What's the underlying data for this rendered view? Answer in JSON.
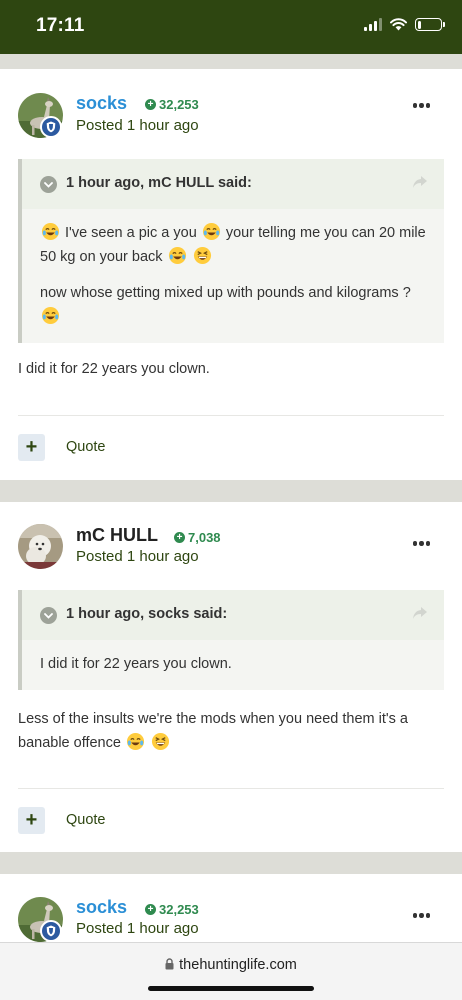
{
  "status_bar": {
    "time": "17:11",
    "battery_level": 0.15
  },
  "posts": [
    {
      "author": "socks",
      "author_color": "#2b8fd6",
      "reputation": "32,253",
      "posted": "Posted 1 hour ago",
      "moderator_badge": true,
      "avatar": "dog-avatar",
      "quote": {
        "cite": "1 hour ago, mC HULL said:",
        "paragraphs": [
          {
            "a": "I've seen a pic a you",
            "b": "your telling me you can 20 mile  50 kg on your back"
          },
          {
            "a": "now whose getting mixed up with pounds and kilograms ?"
          }
        ]
      },
      "text": "I did it for 22 years you clown.",
      "quote_label": "Quote"
    },
    {
      "author": "mC HULL",
      "author_color": "#222222",
      "reputation": "7,038",
      "posted": "Posted 1 hour ago",
      "moderator_badge": false,
      "avatar": "white-dog-avatar",
      "quote": {
        "cite": "1 hour ago, socks said:",
        "paragraphs": [
          {
            "a": "I did it for 22 years you clown."
          }
        ]
      },
      "text": "Less of the insults we're the mods when you need them it's a banable offence",
      "quote_label": "Quote"
    },
    {
      "author": "socks",
      "author_color": "#2b8fd6",
      "reputation": "32,253",
      "posted": "Posted 1 hour ago",
      "moderator_badge": true,
      "avatar": "dog-avatar"
    }
  ],
  "browser": {
    "url": "thehuntinglife.com"
  },
  "icons": {
    "reputation": "plus-circle-icon",
    "more": "ellipsis-icon",
    "chevron": "chevron-down-icon",
    "share": "share-arrow-icon",
    "add": "plus-icon",
    "lock": "lock-icon",
    "emoji_laugh": "tears-of-joy-emoji",
    "emoji_grin": "grinning-squinting-emoji"
  },
  "colors": {
    "brand_green": "#2e4611",
    "link_blue": "#2b8fd6",
    "rep_green": "#2f8a4f"
  }
}
